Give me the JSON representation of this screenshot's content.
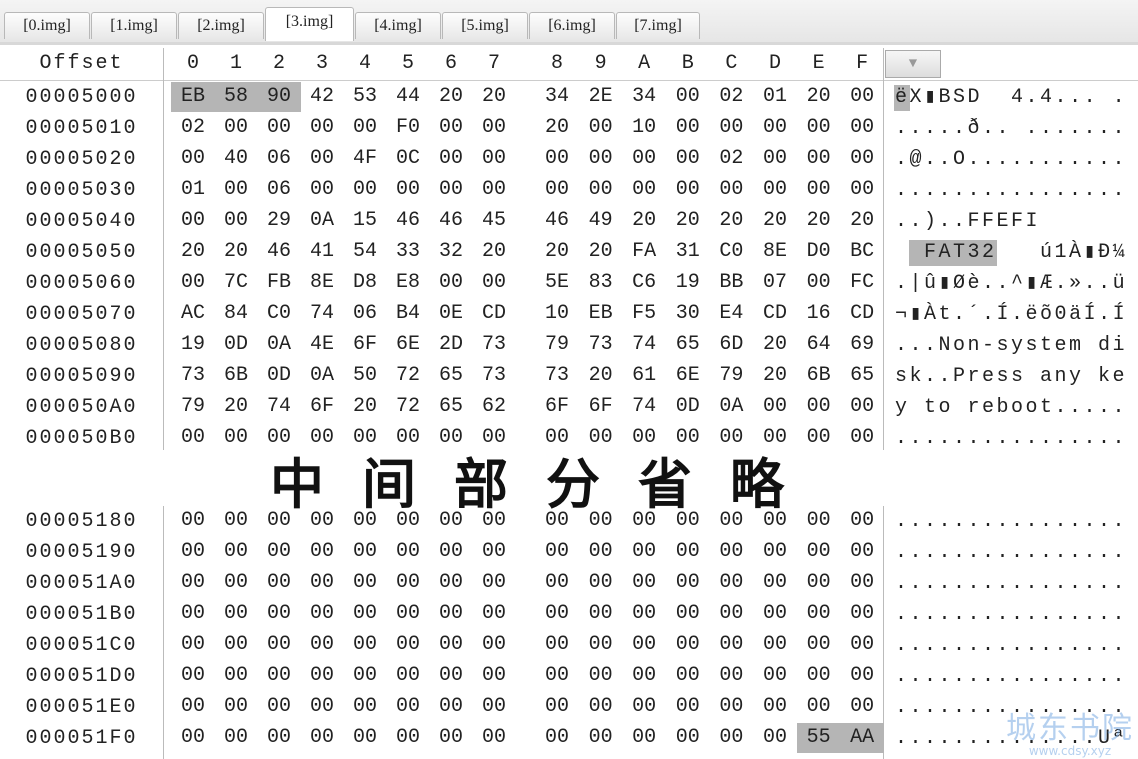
{
  "tabs": [
    "[0.img]",
    "[1.img]",
    "[2.img]",
    "[3.img]",
    "[4.img]",
    "[5.img]",
    "[6.img]",
    "[7.img]"
  ],
  "active_tab": 3,
  "header": {
    "offset_label": "Offset",
    "columns": [
      "0",
      "1",
      "2",
      "3",
      "4",
      "5",
      "6",
      "7",
      "8",
      "9",
      "A",
      "B",
      "C",
      "D",
      "E",
      "F"
    ],
    "dropdown_icon": "chevron-down-icon"
  },
  "highlight_color": "#b5b5b5",
  "rows_top": [
    {
      "offset": "00005000",
      "hex": "EB 58 90 42 53 44 20 20 34 2E 34 00 02 01 20 00",
      "ascii": "ëX▮BSD  4.4... .",
      "hex_hl": [
        0,
        1,
        2
      ],
      "ascii_hl": [
        0
      ]
    },
    {
      "offset": "00005010",
      "hex": "02 00 00 00 00 F0 00 00 20 00 10 00 00 00 00 00",
      "ascii": ".....ð.. ......."
    },
    {
      "offset": "00005020",
      "hex": "00 40 06 00 4F 0C 00 00 00 00 00 00 02 00 00 00",
      "ascii": ".@..O..........."
    },
    {
      "offset": "00005030",
      "hex": "01 00 06 00 00 00 00 00 00 00 00 00 00 00 00 00",
      "ascii": "................"
    },
    {
      "offset": "00005040",
      "hex": "00 00 29 0A 15 46 46 45 46 49 20 20 20 20 20 20",
      "ascii": "..)..FFEFI      "
    },
    {
      "offset": "00005050",
      "hex": "20 20 46 41 54 33 32 20 20 20 FA 31 C0 8E D0 BC",
      "ascii": "  FAT32   ú1À▮Ð¼",
      "ascii_hl": [
        1,
        2,
        3,
        4,
        5,
        6
      ]
    },
    {
      "offset": "00005060",
      "hex": "00 7C FB 8E D8 E8 00 00 5E 83 C6 19 BB 07 00 FC",
      "ascii": ".|û▮Øè..^▮Æ.»..ü"
    },
    {
      "offset": "00005070",
      "hex": "AC 84 C0 74 06 B4 0E CD 10 EB F5 30 E4 CD 16 CD",
      "ascii": "¬▮Àt.´.Í.ëõ0äÍ.Í"
    },
    {
      "offset": "00005080",
      "hex": "19 0D 0A 4E 6F 6E 2D 73 79 73 74 65 6D 20 64 69",
      "ascii": "...Non-system di"
    },
    {
      "offset": "00005090",
      "hex": "73 6B 0D 0A 50 72 65 73 73 20 61 6E 79 20 6B 65",
      "ascii": "sk..Press any ke"
    },
    {
      "offset": "000050A0",
      "hex": "79 20 74 6F 20 72 65 62 6F 6F 74 0D 0A 00 00 00",
      "ascii": "y to reboot....."
    },
    {
      "offset": "000050B0",
      "hex": "00 00 00 00 00 00 00 00 00 00 00 00 00 00 00 00",
      "ascii": "................"
    }
  ],
  "omitted_label": "中间部分省略",
  "rows_bottom": [
    {
      "offset": "00005180",
      "hex": "00 00 00 00 00 00 00 00 00 00 00 00 00 00 00 00",
      "ascii": "................"
    },
    {
      "offset": "00005190",
      "hex": "00 00 00 00 00 00 00 00 00 00 00 00 00 00 00 00",
      "ascii": "................"
    },
    {
      "offset": "000051A0",
      "hex": "00 00 00 00 00 00 00 00 00 00 00 00 00 00 00 00",
      "ascii": "................"
    },
    {
      "offset": "000051B0",
      "hex": "00 00 00 00 00 00 00 00 00 00 00 00 00 00 00 00",
      "ascii": "................"
    },
    {
      "offset": "000051C0",
      "hex": "00 00 00 00 00 00 00 00 00 00 00 00 00 00 00 00",
      "ascii": "................"
    },
    {
      "offset": "000051D0",
      "hex": "00 00 00 00 00 00 00 00 00 00 00 00 00 00 00 00",
      "ascii": "................"
    },
    {
      "offset": "000051E0",
      "hex": "00 00 00 00 00 00 00 00 00 00 00 00 00 00 00 00",
      "ascii": "................"
    },
    {
      "offset": "000051F0",
      "hex": "00 00 00 00 00 00 00 00 00 00 00 00 00 00 55 AA",
      "ascii": "..............Uª",
      "hex_hl": [
        14,
        15
      ]
    }
  ],
  "watermark": {
    "title": "城东书院",
    "url": "www.cdsy.xyz"
  }
}
